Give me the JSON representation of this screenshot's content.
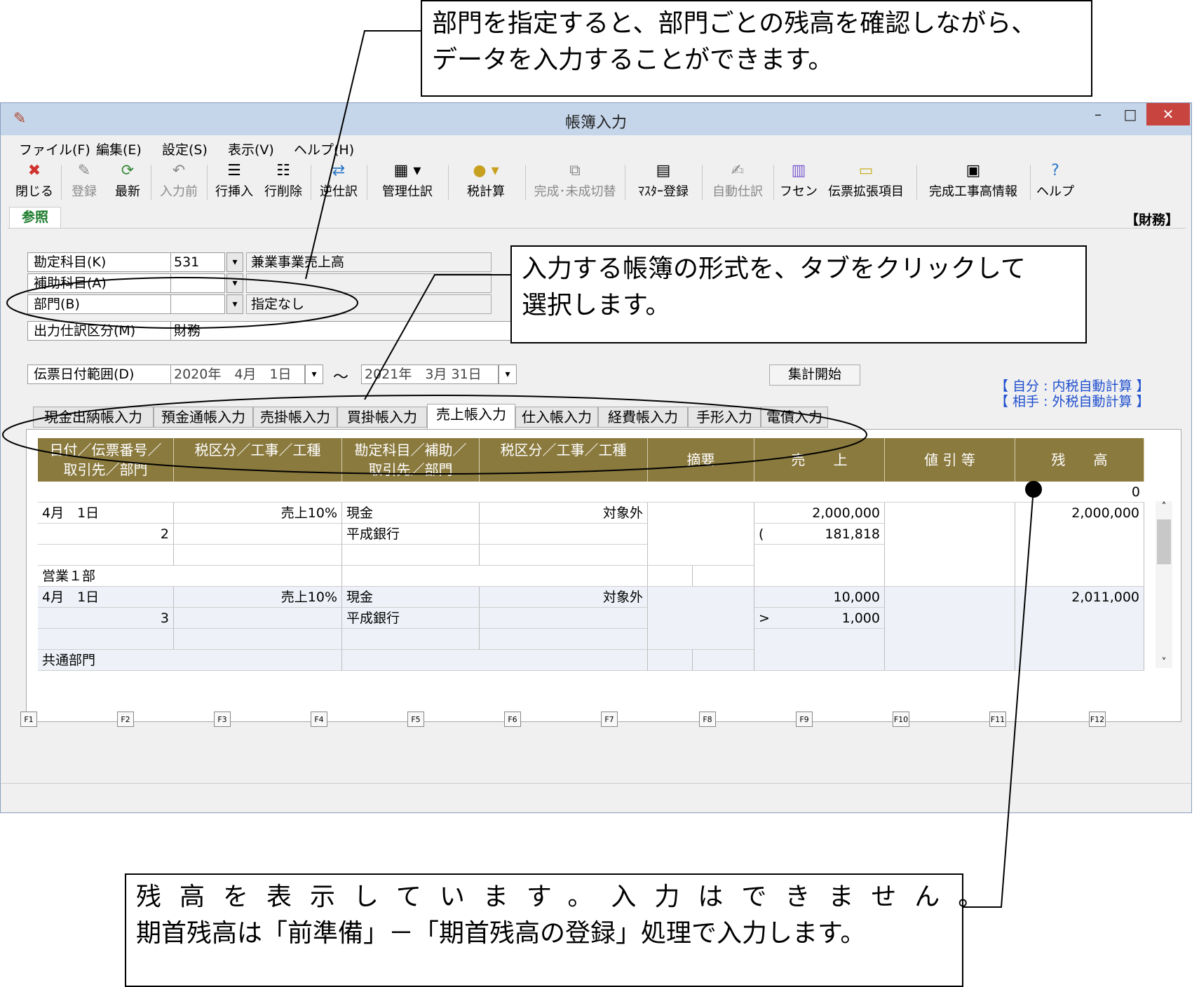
{
  "callouts": {
    "top": [
      "部門を指定すると、部門ごとの残高を確認しながら、",
      "データを入力することができます。"
    ],
    "tab": [
      "入力する帳簿の形式を、タブをクリックして",
      "選択します。"
    ],
    "bottom": [
      "残高を表示しています。入力はできません。",
      "期首残高は「前準備」－「期首残高の登録」処理で入力します。"
    ]
  },
  "window": {
    "title": "帳簿入力",
    "icon": "pencil-icon"
  },
  "menu": [
    "ファイル(F)",
    "編集(E)",
    "設定(S)",
    "表示(V)",
    "ヘルプ(H)"
  ],
  "toolbar": [
    {
      "label": "閉じる",
      "icon": "close-icon",
      "enabled": true
    },
    {
      "label": "登録",
      "icon": "register-icon",
      "enabled": false
    },
    {
      "label": "最新",
      "icon": "refresh-icon",
      "enabled": true
    },
    {
      "label": "入力前",
      "icon": "undo-icon",
      "enabled": false
    },
    {
      "label": "行挿入",
      "icon": "insert-row-icon",
      "enabled": true
    },
    {
      "label": "行削除",
      "icon": "delete-row-icon",
      "enabled": true
    },
    {
      "label": "逆仕訳",
      "icon": "reverse-entry-icon",
      "enabled": true
    },
    {
      "label": "管理仕訳",
      "icon": "manage-entry-icon",
      "enabled": true
    },
    {
      "label": "税計算",
      "icon": "tax-calc-icon",
      "enabled": true
    },
    {
      "label": "完成･未成切替",
      "icon": "switch-icon",
      "enabled": false
    },
    {
      "label": "ﾏｽﾀｰ登録",
      "icon": "master-icon",
      "enabled": true
    },
    {
      "label": "自動仕訳",
      "icon": "auto-entry-icon",
      "enabled": false
    },
    {
      "label": "フセン",
      "icon": "sticky-icon",
      "enabled": true
    },
    {
      "label": "伝票拡張項目",
      "icon": "note-icon",
      "enabled": true
    },
    {
      "label": "完成工事高情報",
      "icon": "info-icon",
      "enabled": true
    },
    {
      "label": "ヘルプ",
      "icon": "help-icon",
      "enabled": true
    }
  ],
  "ref_tab": "参照",
  "mode": "【財務】",
  "form": {
    "account": {
      "label": "勘定科目(K)",
      "code": "531",
      "name": "兼業事業売上高"
    },
    "sub_account": {
      "label": "補助科目(A)",
      "code": "",
      "name": ""
    },
    "department": {
      "label": "部門(B)",
      "code": "",
      "name": "指定なし"
    },
    "output": {
      "label": "出力仕訳区分(M)",
      "value": "財務"
    },
    "date_range": {
      "label": "伝票日付範囲(D)",
      "from": "2020年　4月　1日",
      "to": "2021年　3月 31日",
      "tilde": "～"
    },
    "aggregate_button": "集計開始",
    "tax_notes": [
      "【 自分 : 内税自動計算 】",
      "【 相手 : 外税自動計算 】"
    ]
  },
  "tabs": [
    "現金出納帳入力",
    "預金通帳入力",
    "売掛帳入力",
    "買掛帳入力",
    "売上帳入力",
    "仕入帳入力",
    "経費帳入力",
    "手形入力",
    "電債入力"
  ],
  "active_tab": 4,
  "grid": {
    "headers": [
      "日付／伝票番号／\n取引先／部門",
      "税区分／工事／工種",
      "勘定科目／補助／\n取引先／部門",
      "税区分／工事／工種",
      "摘要",
      "売　　上",
      "値 引 等",
      "残　　高"
    ],
    "opening_balance": "0",
    "entries": [
      {
        "date": "4月　1日",
        "no": "2",
        "tax": "売上10%",
        "account": "現金",
        "sub": "平成銀行",
        "tax2": "対象外",
        "sales": "2,000,000",
        "tax_amount": "181,818",
        "tax_mark": "(",
        "balance": "2,000,000",
        "dept": "営業１部"
      },
      {
        "date": "4月　1日",
        "no": "3",
        "tax": "売上10%",
        "account": "現金",
        "sub": "平成銀行",
        "tax2": "対象外",
        "sales": "10,000",
        "tax_amount": "1,000",
        "tax_mark": ">",
        "balance": "2,011,000",
        "dept": "共通部門"
      }
    ]
  },
  "fkeys": [
    "F1",
    "F2",
    "F3",
    "F4",
    "F5",
    "F6",
    "F7",
    "F8",
    "F9",
    "F10",
    "F11",
    "F12"
  ]
}
